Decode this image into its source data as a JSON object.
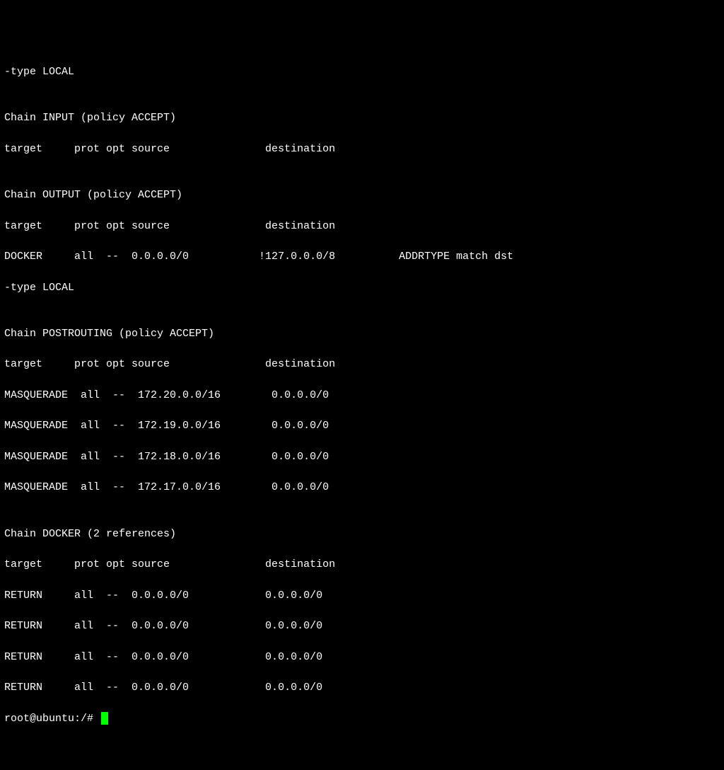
{
  "lines": {
    "l0": "-type LOCAL",
    "l1": "",
    "l2": "Chain INPUT (policy ACCEPT)",
    "l3": "target     prot opt source               destination",
    "l4": "",
    "l5": "Chain OUTPUT (policy ACCEPT)",
    "l6": "target     prot opt source               destination",
    "l7": "DOCKER     all  --  0.0.0.0/0           !127.0.0.0/8          ADDRTYPE match dst",
    "l8": "-type LOCAL",
    "l9": "",
    "l10": "Chain POSTROUTING (policy ACCEPT)",
    "l11": "target     prot opt source               destination",
    "l12": "MASQUERADE  all  --  172.20.0.0/16        0.0.0.0/0",
    "l13": "MASQUERADE  all  --  172.19.0.0/16        0.0.0.0/0",
    "l14": "MASQUERADE  all  --  172.18.0.0/16        0.0.0.0/0",
    "l15": "MASQUERADE  all  --  172.17.0.0/16        0.0.0.0/0",
    "l16": "",
    "l17": "Chain DOCKER (2 references)",
    "l18": "target     prot opt source               destination",
    "l19": "RETURN     all  --  0.0.0.0/0            0.0.0.0/0",
    "l20": "RETURN     all  --  0.0.0.0/0            0.0.0.0/0",
    "l21": "RETURN     all  --  0.0.0.0/0            0.0.0.0/0",
    "l22": "RETURN     all  --  0.0.0.0/0            0.0.0.0/0"
  },
  "prompt": "root@ubuntu:/# "
}
